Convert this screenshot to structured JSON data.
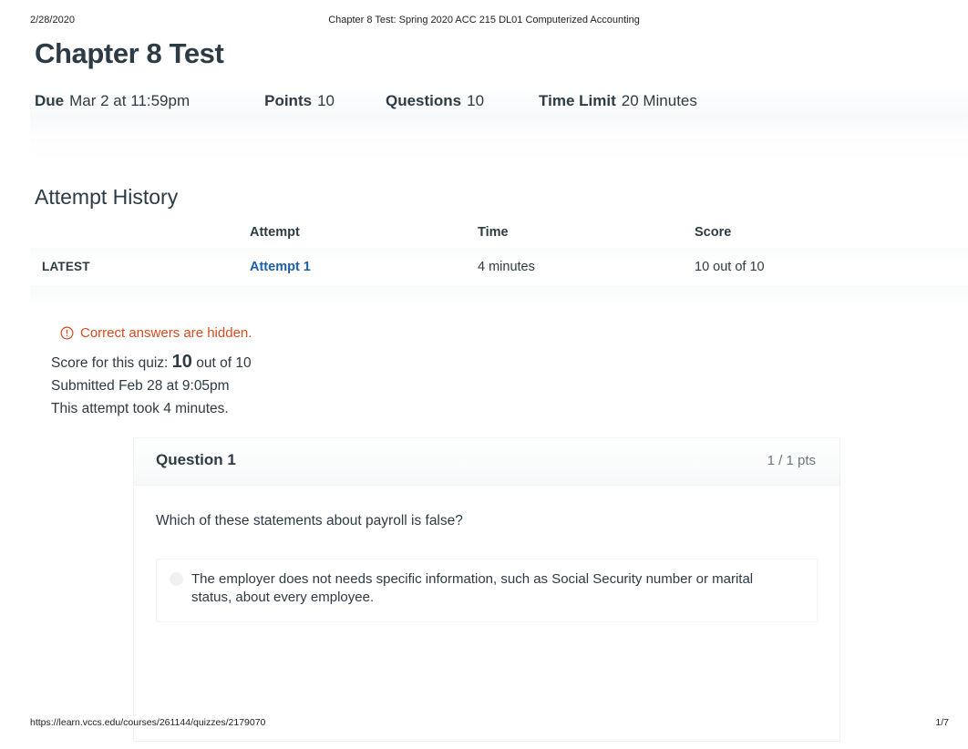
{
  "print": {
    "date": "2/28/2020",
    "header_title": "Chapter 8 Test: Spring 2020 ACC 215 DL01 Computerized Accounting",
    "footer_url": "https://learn.vccs.edu/courses/261144/quizzes/2179070",
    "page_number": "1/7"
  },
  "quiz": {
    "title": "Chapter 8 Test",
    "meta": [
      {
        "label": "Due",
        "value": "Mar 2 at 11:59pm"
      },
      {
        "label": "Points",
        "value": "10"
      },
      {
        "label": "Questions",
        "value": "10"
      },
      {
        "label": "Time Limit",
        "value": "20 Minutes"
      }
    ]
  },
  "attempt_history": {
    "heading": "Attempt History",
    "columns": [
      "",
      "Attempt",
      "Time",
      "Score"
    ],
    "rows": [
      {
        "kept": "LATEST",
        "attempt": "Attempt 1",
        "time": "4 minutes",
        "score": "10 out of 10"
      }
    ]
  },
  "notice": {
    "icon": "warning-circle-icon",
    "text": "Correct answers are hidden.",
    "color": "#d64b1f"
  },
  "score_summary": {
    "score_prefix": "Score for this quiz:",
    "score_value": "10",
    "score_suffix": "out of 10",
    "submitted": "Submitted Feb 28 at 9:05pm",
    "duration": "This attempt took 4 minutes."
  },
  "question": {
    "name": "Question 1",
    "points": "1 / 1 pts",
    "text": "Which of these statements about payroll is false?",
    "answers": [
      {
        "selected": false,
        "text": "The employer does not needs specific information, such as Social Security number or marital status, about every employee."
      }
    ]
  },
  "colors": {
    "link": "#1b5eab",
    "text": "#2d3b45",
    "warning": "#d64b1f",
    "muted": "#6b7780"
  }
}
